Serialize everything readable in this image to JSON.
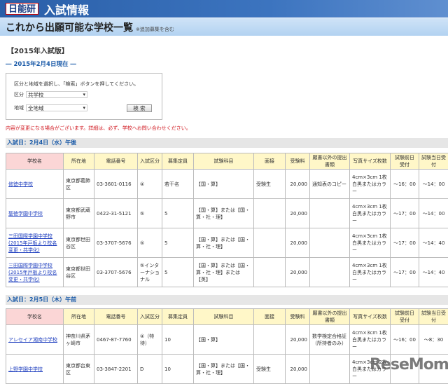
{
  "header": {
    "logo": "日能研",
    "title": "入試情報"
  },
  "subheader": {
    "title": "これから出願可能な学校一覧",
    "note": "※追加募集を含む"
  },
  "edition": "【2015年入試版】",
  "as_of": "― 2015年2月4日現在 ―",
  "search": {
    "instruction": "区分と地域を選択し、「検索」ボタンを押してください。",
    "category_label": "区分",
    "category_value": "共学校",
    "region_label": "地域",
    "region_value": "全地域",
    "search_button": "検 索"
  },
  "warning": "内容が変更になる場合がございます。詳細は、必ず、学校へお問い合わせください。",
  "columns": [
    "学校名",
    "所在地",
    "電話番号",
    "入試区分",
    "募集定員",
    "試験科目",
    "面接",
    "受験料",
    "願書以外の提出書類",
    "写真サイズ枚数",
    "試験前日受付",
    "試験当日受付"
  ],
  "sections": [
    {
      "title": "入試日：2月4日（水）午後",
      "rows": [
        [
          "修徳中学校",
          "東京都葛飾区",
          "03-3601-0116",
          "④",
          "若干名",
          "【国・算】",
          "受験生",
          "20,000",
          "通知表のコピー",
          "4cm×3cm 1枚 白黒またはカラー",
          "～16：00",
          "～14：00"
        ],
        [
          "聖徳学園中学校",
          "東京都武蔵野市",
          "0422-31-5121",
          "⑤",
          "5",
          "【国・算】または【国・算・社・理】",
          "",
          "20,000",
          "",
          "4cm×3cm 1枚 白黒またはカラー",
          "～17：00",
          "～14：00"
        ],
        [
          "三田国際学園中学校(2015年戸板より校名変更・共学化)",
          "東京都世田谷区",
          "03-3707-5676",
          "⑤",
          "5",
          "【国・算】または【国・算・社・理】",
          "",
          "20,000",
          "",
          "4cm×3cm 1枚 白黒またはカラー",
          "～17：00",
          "～14：40"
        ],
        [
          "三田国際学園中学校(2015年戸板より校名変更・共学化)",
          "東京都世田谷区",
          "03-3707-5676",
          "⑤インターナショナル",
          "5",
          "【国・算】または【国・算・社・理】または【英】",
          "",
          "20,000",
          "",
          "4cm×3cm 1枚 白黒またはカラー",
          "～17：00",
          "～14：40"
        ]
      ]
    },
    {
      "title": "入試日：2月5日（木）午前",
      "rows": [
        [
          "アレセイア湘南中学校",
          "神奈川県茅ヶ崎市",
          "0467-87-7760",
          "④（特待）",
          "10",
          "【国・算】",
          "",
          "20,000",
          "数学検定合格証（所持者のみ）",
          "4cm×3cm 1枚 白黒またはカラー",
          "～16：00",
          "～8：30"
        ],
        [
          "上野学園中学校",
          "東京都台東区",
          "03-3847-2201",
          "D",
          "10",
          "【国・算】または【国・算・社・理】",
          "受験生",
          "20,000",
          "",
          "4cm×3cm 2枚 白黒またはカラー",
          "",
          ""
        ]
      ]
    }
  ],
  "watermark": "ReseMom"
}
